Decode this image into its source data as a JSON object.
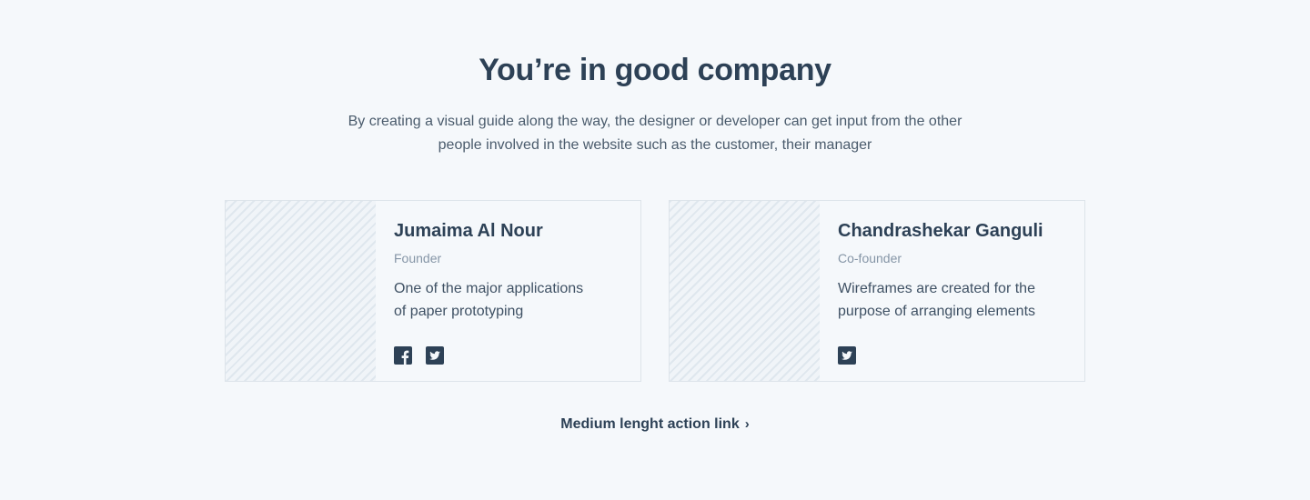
{
  "header": {
    "title": "You’re in good company",
    "subtitle_line1": "By creating a visual guide along the way, the designer or developer can get input from the other",
    "subtitle_line2": "people involved in the website such as the customer, their manager"
  },
  "team": [
    {
      "name": "Jumaima Al Nour",
      "role": "Founder",
      "bio_line1": "One of the major applications",
      "bio_line2": "of paper prototyping",
      "socials": [
        "facebook-icon",
        "twitter-icon"
      ]
    },
    {
      "name": "Chandrashekar Ganguli",
      "role": "Co-founder",
      "bio_line1": "Wireframes are created for the",
      "bio_line2": "purpose of arranging elements",
      "socials": [
        "twitter-icon"
      ]
    }
  ],
  "action": {
    "label": "Medium lenght action link",
    "chevron": "›"
  },
  "colors": {
    "background": "#f5f8fb",
    "heading": "#2d4156",
    "muted": "#8595a6",
    "border": "#dde4ea"
  }
}
